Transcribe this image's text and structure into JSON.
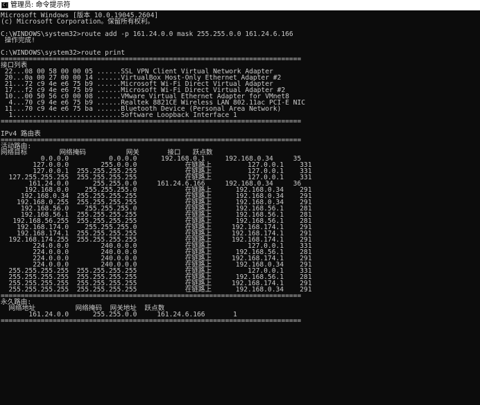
{
  "window": {
    "title": "管理员: 命令提示符",
    "icon": "cmd-icon",
    "background": "#0c0c0c",
    "foreground": "#cccccc"
  },
  "console": {
    "lines": [
      "Microsoft Windows [版本 10.0.19045.2604]",
      "(c) Microsoft Corporation。保留所有权利。",
      "",
      "C:\\WINDOWS\\system32>route add -p 161.24.0.0 mask 255.255.0.0 161.24.6.166",
      " 操作完成!",
      "",
      "C:\\WINDOWS\\system32>route print",
      "===========================================================================",
      "接口列表",
      " 22...08 00 58 00 00 05 ......SSL VPN Client Virtual Network Adapter",
      " 20...0a 00 27 00 00 14 ......VirtualBox Host-Only Ethernet Adapter #2",
      " 21...72 c9 4e e6 75 b9 ......Microsoft Wi-Fi Direct Virtual Adapter",
      " 17...f2 c9 4e e6 75 b9 ......Microsoft Wi-Fi Direct Virtual Adapter #2",
      " 10...00 50 56 c0 00 08 ......VMware Virtual Ethernet Adapter for VMnet8",
      "  4...70 c9 4e e6 75 b9 ......Realtek 8821CE Wireless LAN 802.11ac PCI-E NIC",
      " 11...70 c9 4e e6 75 ba ......Bluetooth Device (Personal Area Network)",
      "  1...........................Software Loopback Interface 1",
      "===========================================================================",
      "",
      "IPv4 路由表",
      "===========================================================================",
      "活动路由:",
      "网络目标        网络掩码          网关       接口   跃点数",
      "          0.0.0.0          0.0.0.0      192.168.0.1     192.168.0.34     35",
      "        127.0.0.0        255.0.0.0            在链路上         127.0.0.1    331",
      "        127.0.0.1  255.255.255.255            在链路上         127.0.0.1    331",
      "  127.255.255.255  255.255.255.255            在链路上         127.0.0.1    331",
      "       161.24.0.0      255.255.0.0     161.24.6.166     192.168.0.34     36",
      "      192.168.0.0    255.255.255.0            在链路上      192.168.0.34    291",
      "     192.168.0.34  255.255.255.255            在链路上      192.168.0.34    291",
      "    192.168.0.255  255.255.255.255            在链路上      192.168.0.34    291",
      "     192.168.56.0    255.255.255.0            在链路上      192.168.56.1    281",
      "     192.168.56.1  255.255.255.255            在链路上      192.168.56.1    281",
      "   192.168.56.255  255.255.255.255            在链路上      192.168.56.1    281",
      "    192.168.174.0    255.255.255.0            在链路上     192.168.174.1    291",
      "    192.168.174.1  255.255.255.255            在链路上     192.168.174.1    291",
      "  192.168.174.255  255.255.255.255            在链路上     192.168.174.1    291",
      "        224.0.0.0        240.0.0.0            在链路上         127.0.0.1    331",
      "        224.0.0.0        240.0.0.0            在链路上      192.168.56.1    281",
      "        224.0.0.0        240.0.0.0            在链路上     192.168.174.1    291",
      "        224.0.0.0        240.0.0.0            在链路上      192.168.0.34    291",
      "  255.255.255.255  255.255.255.255            在链路上         127.0.0.1    331",
      "  255.255.255.255  255.255.255.255            在链路上      192.168.56.1    281",
      "  255.255.255.255  255.255.255.255            在链路上     192.168.174.1    291",
      "  255.255.255.255  255.255.255.255            在链路上      192.168.0.34    291",
      "===========================================================================",
      "永久路由:",
      "  网络地址          网络掩码  网关地址  跃点数",
      "       161.24.0.0      255.255.0.0     161.24.6.166       1",
      "==========================================================================="
    ]
  }
}
